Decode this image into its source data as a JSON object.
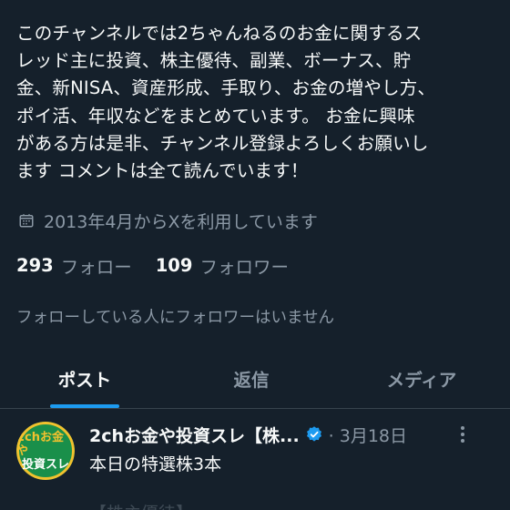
{
  "profile": {
    "bio_lines": [
      "このチャンネルでは2ちゃんねるのお金に関するス",
      "レッド主に投資、株主優待、副業、ボーナス、貯",
      "金、新NISA、資産形成、手取り、お金の増やし方、",
      "ポイ活、年収などをまとめています。 お金に興味",
      "がある方は是非、チャンネル登録よろしくお願いし",
      "ます コメントは全て読んでいます！"
    ],
    "joined": "2013年4月からXを利用しています",
    "joined_icon": "calendar-icon",
    "following_count": "293",
    "following_label": "フォロー",
    "followers_count": "109",
    "followers_label": "フォロワー",
    "no_mutual_text": "フォローしている人にフォロワーはいません"
  },
  "tabs": [
    {
      "label": "ポスト",
      "active": true
    },
    {
      "label": "返信",
      "active": false
    },
    {
      "label": "メディア",
      "active": false
    }
  ],
  "post": {
    "author": "2chお金や投資スレ【株...",
    "date": "· 3月18日",
    "text": "本日の特選株3本",
    "avatar_line1": "2chお金や",
    "avatar_line2": "投資スレ",
    "next_line": "【株主優待】"
  },
  "colors": {
    "background": "#15202b",
    "accent": "#1d9bf0",
    "muted": "#8b98a5"
  }
}
